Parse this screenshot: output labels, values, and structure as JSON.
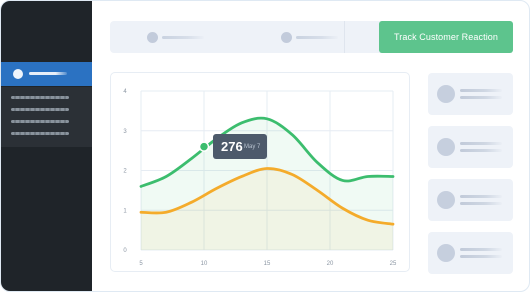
{
  "tabs": {
    "active_label": "Track Customer Reaction"
  },
  "tooltip": {
    "value": "276",
    "date": "May 7"
  },
  "chart_data": {
    "type": "line",
    "x_ticks": [
      "5",
      "10",
      "15",
      "20",
      "25"
    ],
    "y_ticks": [
      "0",
      "1",
      "2",
      "3",
      "4"
    ],
    "xlim": [
      5,
      25
    ],
    "ylim": [
      0,
      4
    ],
    "grid": true,
    "series": [
      {
        "color": "#3cbd6e",
        "x": [
          5,
          7,
          9,
          11,
          13,
          15,
          17,
          19,
          21,
          23,
          25
        ],
        "values": [
          1.6,
          1.85,
          2.3,
          2.8,
          3.2,
          3.3,
          2.9,
          2.2,
          1.75,
          1.85,
          1.85
        ]
      },
      {
        "color": "#f4ab2b",
        "x": [
          5,
          7,
          9,
          11,
          13,
          15,
          17,
          19,
          21,
          23,
          25
        ],
        "values": [
          0.95,
          0.95,
          1.2,
          1.55,
          1.85,
          2.05,
          1.9,
          1.5,
          1.05,
          0.75,
          0.65
        ]
      }
    ],
    "highlight_point": {
      "series": 0,
      "x": 10,
      "y": 2.6
    }
  },
  "colors": {
    "accent": "#5dc48d",
    "sidebar_bg": "#1f2429",
    "sidebar_active": "#2b72c2",
    "grid": "#e6ecf3"
  }
}
